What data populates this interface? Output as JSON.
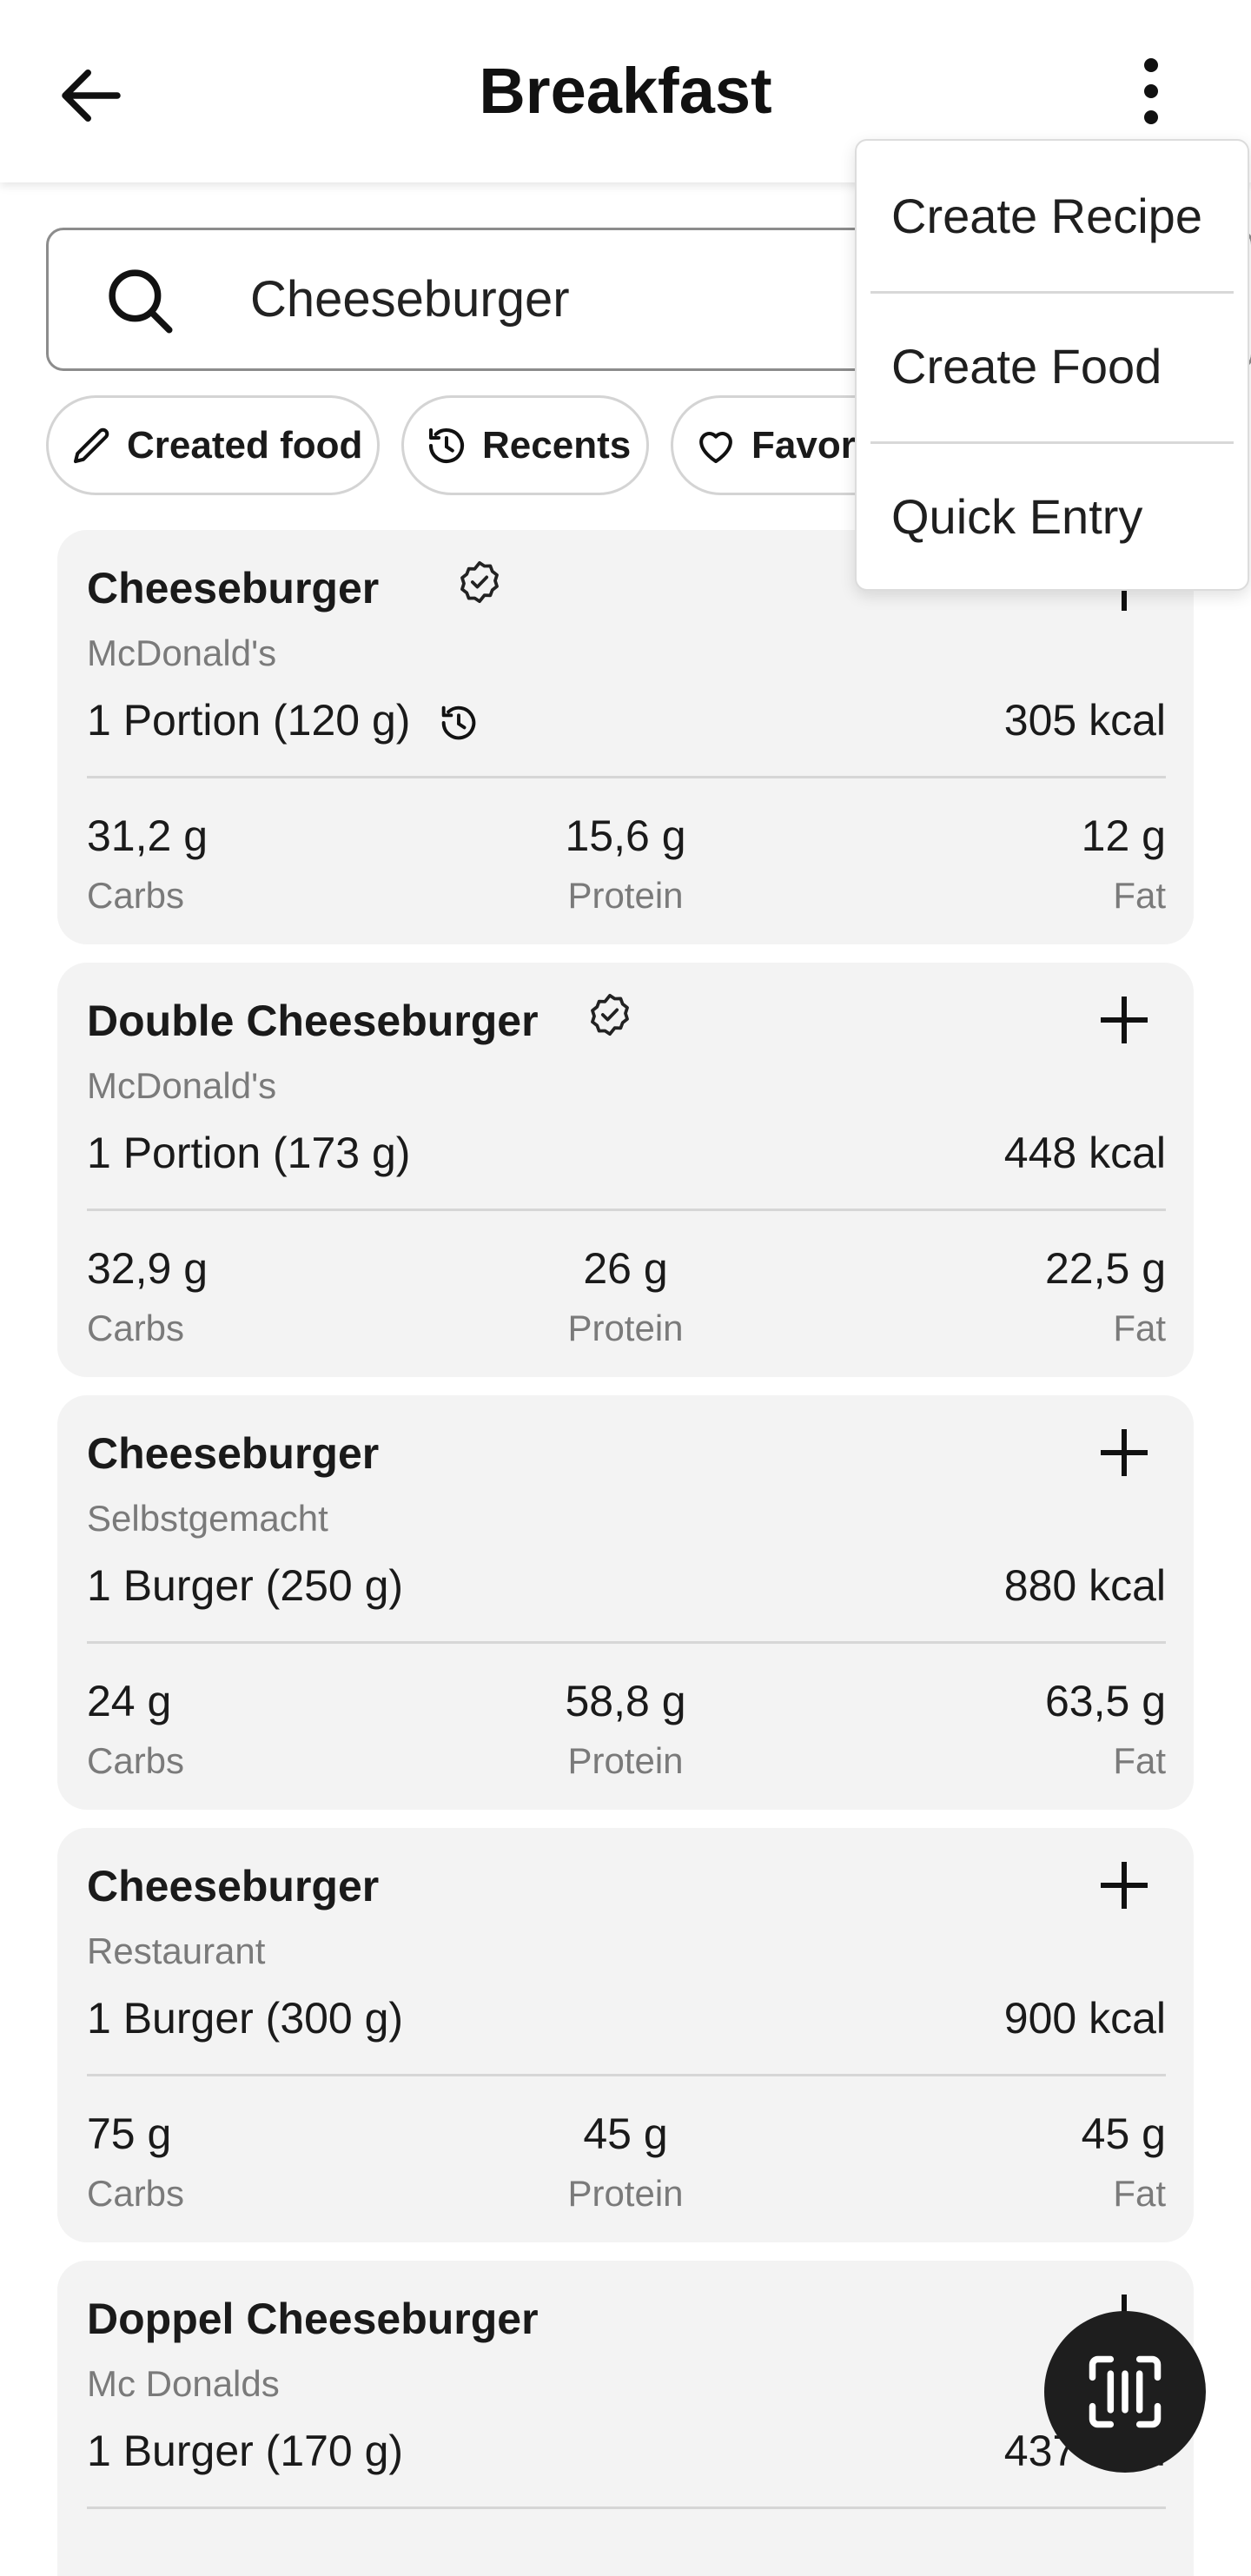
{
  "appbar": {
    "title": "Breakfast",
    "back_icon": "arrow-left-icon",
    "menu_icon": "more-vert-icon"
  },
  "search": {
    "value": "Cheeseburger",
    "icon": "search-icon"
  },
  "chips": [
    {
      "label": "Created food",
      "icon": "pencil-icon"
    },
    {
      "label": "Recents",
      "icon": "history-icon"
    },
    {
      "label": "Favorites",
      "icon": "heart-icon"
    }
  ],
  "menu": {
    "items": [
      "Create Recipe",
      "Create Food",
      "Quick Entry"
    ]
  },
  "foods": [
    {
      "name": "Cheeseburger",
      "verified": true,
      "brand": "McDonald's",
      "serving": "1 Portion (120 g)",
      "recent": true,
      "kcal": "305 kcal",
      "carbs": "31,2 g",
      "protein": "15,6 g",
      "fat": "12 g"
    },
    {
      "name": "Double Cheeseburger",
      "verified": true,
      "brand": "McDonald's",
      "serving": "1 Portion (173 g)",
      "recent": false,
      "kcal": "448 kcal",
      "carbs": "32,9 g",
      "protein": "26 g",
      "fat": "22,5 g"
    },
    {
      "name": "Cheeseburger",
      "verified": false,
      "brand": "Selbstgemacht",
      "serving": "1 Burger (250 g)",
      "recent": false,
      "kcal": "880 kcal",
      "carbs": "24 g",
      "protein": "58,8 g",
      "fat": "63,5 g"
    },
    {
      "name": "Cheeseburger",
      "verified": false,
      "brand": "Restaurant",
      "serving": "1 Burger (300 g)",
      "recent": false,
      "kcal": "900 kcal",
      "carbs": "75 g",
      "protein": "45 g",
      "fat": "45 g"
    },
    {
      "name": "Doppel Cheeseburger",
      "verified": false,
      "brand": "Mc Donalds",
      "serving": "1 Burger (170 g)",
      "recent": false,
      "kcal": "437 kcal",
      "carbs": "",
      "protein": "",
      "fat": ""
    }
  ],
  "labels": {
    "carbs": "Carbs",
    "protein": "Protein",
    "fat": "Fat"
  },
  "fab": {
    "icon": "barcode-scan-icon"
  },
  "colors": {
    "card_bg": "#f3f3f3",
    "secondary_text": "#7a7a7a",
    "fab_bg": "#1e1e1e"
  }
}
